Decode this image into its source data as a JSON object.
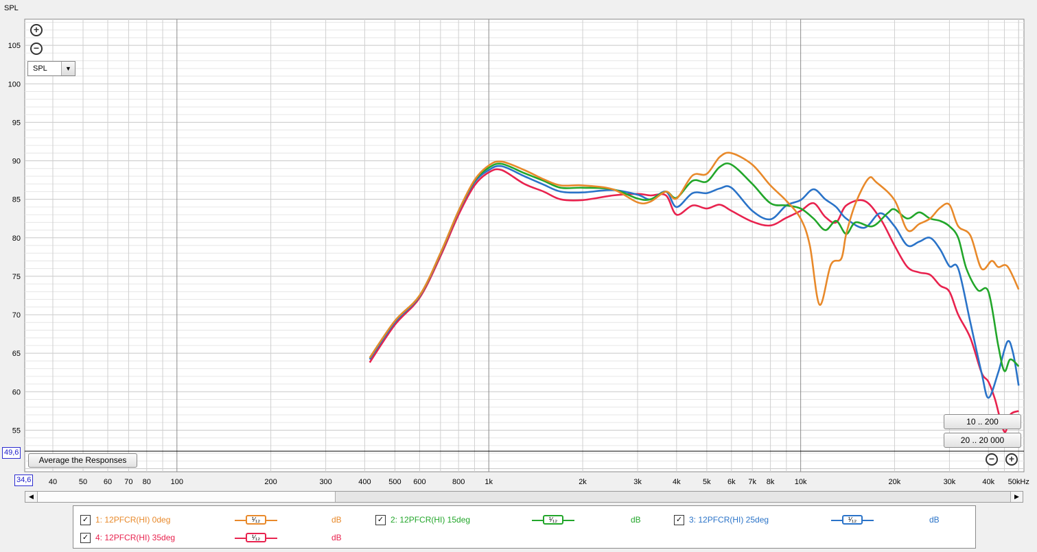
{
  "ylabel_top": "SPL",
  "yaxis": {
    "ticks": [
      55,
      60,
      65,
      70,
      75,
      80,
      85,
      90,
      95,
      100,
      105
    ],
    "min": 49.6,
    "max": 108.4,
    "min_label": "49,6",
    "lower_box": "34,6"
  },
  "xaxis": {
    "labels": [
      {
        "f": 40,
        "t": "40"
      },
      {
        "f": 50,
        "t": "50"
      },
      {
        "f": 60,
        "t": "60"
      },
      {
        "f": 70,
        "t": "70"
      },
      {
        "f": 80,
        "t": "80"
      },
      {
        "f": 100,
        "t": "100"
      },
      {
        "f": 200,
        "t": "200"
      },
      {
        "f": 300,
        "t": "300"
      },
      {
        "f": 400,
        "t": "400"
      },
      {
        "f": 500,
        "t": "500"
      },
      {
        "f": 600,
        "t": "600"
      },
      {
        "f": 800,
        "t": "800"
      },
      {
        "f": 1000,
        "t": "1k"
      },
      {
        "f": 2000,
        "t": "2k"
      },
      {
        "f": 3000,
        "t": "3k"
      },
      {
        "f": 4000,
        "t": "4k"
      },
      {
        "f": 5000,
        "t": "5k"
      },
      {
        "f": 6000,
        "t": "6k"
      },
      {
        "f": 7000,
        "t": "7k"
      },
      {
        "f": 8000,
        "t": "8k"
      },
      {
        "f": 10000,
        "t": "10k"
      },
      {
        "f": 20000,
        "t": "20k"
      },
      {
        "f": 30000,
        "t": "30k"
      },
      {
        "f": 40000,
        "t": "40k"
      },
      {
        "f": 50000,
        "t": "50kHz"
      }
    ]
  },
  "controls": {
    "select_value": "SPL",
    "avg_button": "Average the Responses",
    "range_btn1": "10 .. 200",
    "range_btn2": "20 .. 20 000",
    "zoom_in": "+",
    "zoom_out": "−"
  },
  "chart_data": {
    "type": "line",
    "xscale": "log",
    "xlim": [
      32.5,
      52000
    ],
    "ylim": [
      49.6,
      108.4
    ],
    "grid": true,
    "series": [
      {
        "name": "1: 12PFCR(HI) 0deg",
        "color": "#e8892a",
        "points": [
          [
            415,
            64.4
          ],
          [
            500,
            69.2
          ],
          [
            600,
            72.5
          ],
          [
            700,
            78
          ],
          [
            800,
            83.5
          ],
          [
            900,
            87.5
          ],
          [
            1000,
            89.4
          ],
          [
            1100,
            89.9
          ],
          [
            1300,
            88.8
          ],
          [
            1500,
            87.6
          ],
          [
            1700,
            86.8
          ],
          [
            2000,
            86.8
          ],
          [
            2500,
            86.3
          ],
          [
            3000,
            84.6
          ],
          [
            3300,
            84.7
          ],
          [
            3700,
            86
          ],
          [
            4000,
            85.1
          ],
          [
            4500,
            88.1
          ],
          [
            5000,
            88.3
          ],
          [
            5500,
            90.5
          ],
          [
            6000,
            91
          ],
          [
            7000,
            89.5
          ],
          [
            8000,
            86.8
          ],
          [
            9000,
            84.8
          ],
          [
            10000,
            82.5
          ],
          [
            10700,
            79
          ],
          [
            11500,
            71.3
          ],
          [
            12500,
            76.5
          ],
          [
            13500,
            77.3
          ],
          [
            14000,
            80.5
          ],
          [
            15000,
            84.5
          ],
          [
            16500,
            87.7
          ],
          [
            17500,
            87.2
          ],
          [
            20000,
            84.9
          ],
          [
            22000,
            81
          ],
          [
            24000,
            81.8
          ],
          [
            26000,
            82.5
          ],
          [
            28000,
            83.9
          ],
          [
            30000,
            84.3
          ],
          [
            32000,
            81.5
          ],
          [
            35000,
            80.3
          ],
          [
            38000,
            76
          ],
          [
            41000,
            77
          ],
          [
            43000,
            76.2
          ],
          [
            46000,
            76.3
          ],
          [
            50000,
            73.3
          ]
        ]
      },
      {
        "name": "2: 12PFCR(HI) 15deg",
        "color": "#22a62a",
        "points": [
          [
            415,
            64.4
          ],
          [
            500,
            69.2
          ],
          [
            600,
            72.5
          ],
          [
            700,
            78
          ],
          [
            800,
            83.5
          ],
          [
            900,
            87.4
          ],
          [
            1000,
            89.1
          ],
          [
            1100,
            89.6
          ],
          [
            1300,
            88.4
          ],
          [
            1500,
            87.4
          ],
          [
            1700,
            86.5
          ],
          [
            2000,
            86.5
          ],
          [
            2500,
            86.3
          ],
          [
            3000,
            85.1
          ],
          [
            3300,
            85
          ],
          [
            3700,
            86
          ],
          [
            4000,
            85.2
          ],
          [
            4500,
            87.4
          ],
          [
            5000,
            87.3
          ],
          [
            5500,
            89.2
          ],
          [
            6000,
            89.5
          ],
          [
            7000,
            87
          ],
          [
            8000,
            84.5
          ],
          [
            9000,
            84.2
          ],
          [
            10000,
            83.8
          ],
          [
            11000,
            82.5
          ],
          [
            12000,
            81
          ],
          [
            13000,
            82.2
          ],
          [
            14000,
            80.5
          ],
          [
            15000,
            82
          ],
          [
            17000,
            81.5
          ],
          [
            19000,
            83.2
          ],
          [
            20000,
            83.7
          ],
          [
            22000,
            82.5
          ],
          [
            24000,
            83.3
          ],
          [
            26000,
            82.5
          ],
          [
            28000,
            82.2
          ],
          [
            30000,
            81.5
          ],
          [
            32000,
            80
          ],
          [
            34000,
            76
          ],
          [
            37000,
            73.2
          ],
          [
            40000,
            73
          ],
          [
            43000,
            66
          ],
          [
            45000,
            62.7
          ],
          [
            47000,
            64.2
          ],
          [
            50000,
            63.3
          ]
        ]
      },
      {
        "name": "3: 12PFCR(HI) 25deg",
        "color": "#2a73c8",
        "points": [
          [
            415,
            64.2
          ],
          [
            500,
            69
          ],
          [
            600,
            72.4
          ],
          [
            700,
            77.9
          ],
          [
            800,
            83.4
          ],
          [
            900,
            87.2
          ],
          [
            1000,
            88.8
          ],
          [
            1100,
            89.3
          ],
          [
            1300,
            88
          ],
          [
            1500,
            86.9
          ],
          [
            1700,
            86
          ],
          [
            2000,
            85.9
          ],
          [
            2500,
            86.2
          ],
          [
            3000,
            85.6
          ],
          [
            3300,
            85
          ],
          [
            3700,
            86
          ],
          [
            4000,
            84
          ],
          [
            4500,
            85.8
          ],
          [
            5000,
            85.8
          ],
          [
            5500,
            86.4
          ],
          [
            6000,
            86.5
          ],
          [
            7000,
            83.5
          ],
          [
            8000,
            82.4
          ],
          [
            9000,
            84.2
          ],
          [
            10000,
            84.9
          ],
          [
            11000,
            86.3
          ],
          [
            12000,
            85
          ],
          [
            13000,
            84
          ],
          [
            14000,
            82.5
          ],
          [
            16000,
            81.3
          ],
          [
            18000,
            83.2
          ],
          [
            20000,
            81.5
          ],
          [
            22000,
            79
          ],
          [
            24000,
            79.5
          ],
          [
            26000,
            80
          ],
          [
            28000,
            78.5
          ],
          [
            30000,
            76.3
          ],
          [
            32000,
            76
          ],
          [
            35000,
            69
          ],
          [
            38000,
            62.5
          ],
          [
            40000,
            59.2
          ],
          [
            43000,
            62.5
          ],
          [
            46000,
            66.5
          ],
          [
            48000,
            65
          ],
          [
            50000,
            60.8
          ]
        ]
      },
      {
        "name": "4: 12PFCR(HI) 35deg",
        "color": "#e8224e",
        "points": [
          [
            415,
            63.8
          ],
          [
            500,
            68.7
          ],
          [
            600,
            72.2
          ],
          [
            700,
            77.6
          ],
          [
            800,
            83
          ],
          [
            900,
            86.8
          ],
          [
            1000,
            88.5
          ],
          [
            1100,
            88.8
          ],
          [
            1300,
            87
          ],
          [
            1500,
            86
          ],
          [
            1700,
            85
          ],
          [
            2000,
            84.9
          ],
          [
            2500,
            85.5
          ],
          [
            3000,
            85.7
          ],
          [
            3300,
            85.5
          ],
          [
            3700,
            85.5
          ],
          [
            4000,
            83
          ],
          [
            4500,
            84.2
          ],
          [
            5000,
            83.8
          ],
          [
            5500,
            84.3
          ],
          [
            6000,
            83.5
          ],
          [
            7000,
            82.1
          ],
          [
            8000,
            81.6
          ],
          [
            9000,
            82.6
          ],
          [
            10000,
            83.5
          ],
          [
            11000,
            84.5
          ],
          [
            12000,
            82.7
          ],
          [
            13000,
            82
          ],
          [
            14000,
            84.2
          ],
          [
            16000,
            84.8
          ],
          [
            18000,
            82.5
          ],
          [
            20000,
            79
          ],
          [
            22000,
            76.2
          ],
          [
            24000,
            75.5
          ],
          [
            26000,
            75.2
          ],
          [
            28000,
            73.8
          ],
          [
            30000,
            73
          ],
          [
            32000,
            70
          ],
          [
            35000,
            67
          ],
          [
            38000,
            62.5
          ],
          [
            40000,
            61.3
          ],
          [
            42000,
            59
          ],
          [
            45000,
            54.8
          ],
          [
            47000,
            57
          ],
          [
            50000,
            57.5
          ]
        ]
      }
    ]
  },
  "legend": [
    {
      "id": "s1",
      "check": "✓",
      "label": "1: 12PFCR(HI) 0deg",
      "smoothing": "1/12",
      "unit": "dB",
      "color": "#e8892a"
    },
    {
      "id": "s2",
      "check": "✓",
      "label": "2: 12PFCR(HI) 15deg",
      "smoothing": "1/12",
      "unit": "dB",
      "color": "#22a62a"
    },
    {
      "id": "s3",
      "check": "✓",
      "label": "3: 12PFCR(HI) 25deg",
      "smoothing": "1/12",
      "unit": "dB",
      "color": "#2a73c8"
    },
    {
      "id": "s4",
      "check": "✓",
      "label": "4: 12PFCR(HI) 35deg",
      "smoothing": "1/12",
      "unit": "dB",
      "color": "#e8224e"
    }
  ]
}
